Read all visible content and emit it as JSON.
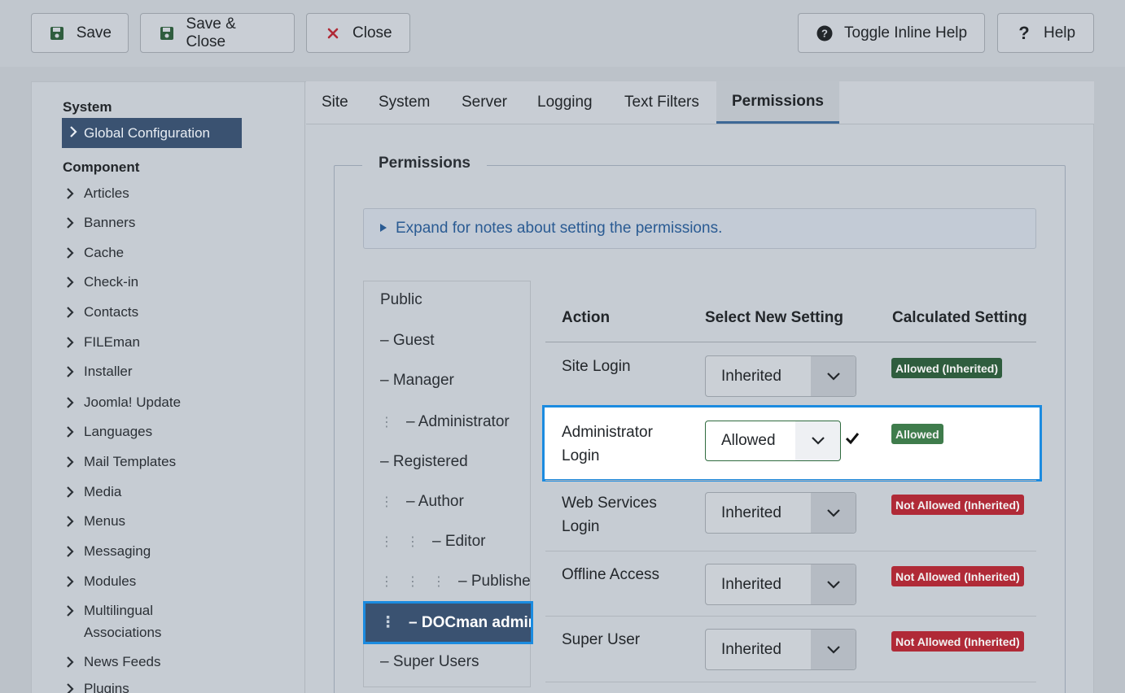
{
  "toolbar": {
    "save": "Save",
    "save_close": "Save & Close",
    "close": "Close",
    "toggle_help": "Toggle Inline Help",
    "help": "Help"
  },
  "sidebar": {
    "system_heading": "System",
    "active_item": "Global Configuration",
    "component_heading": "Component",
    "items": [
      "Articles",
      "Banners",
      "Cache",
      "Check-in",
      "Contacts",
      "FILEman",
      "Installer",
      "Joomla! Update",
      "Languages",
      "Mail Templates",
      "Media",
      "Menus",
      "Messaging",
      "Modules",
      "Multilingual Associations",
      "News Feeds",
      "Plugins"
    ]
  },
  "tabs": [
    "Site",
    "System",
    "Server",
    "Logging",
    "Text Filters",
    "Permissions"
  ],
  "active_tab": "Permissions",
  "permissions": {
    "legend": "Permissions",
    "notes": "Expand for notes about setting the permissions.",
    "groups": [
      {
        "label": "Public",
        "depth": 0
      },
      {
        "label": "– Guest",
        "depth": 0
      },
      {
        "label": "– Manager",
        "depth": 0
      },
      {
        "label": "– Administrator",
        "depth": 1
      },
      {
        "label": "– Registered",
        "depth": 0
      },
      {
        "label": "– Author",
        "depth": 1
      },
      {
        "label": "– Editor",
        "depth": 2
      },
      {
        "label": "– Publisher",
        "depth": 3
      },
      {
        "label": "– DOCman admins",
        "depth": 1
      },
      {
        "label": "– Super Users",
        "depth": 0
      }
    ],
    "active_group": "– DOCman admins",
    "columns": {
      "action": "Action",
      "select": "Select New Setting",
      "calculated": "Calculated Setting"
    },
    "rows": [
      {
        "action": "Site Login",
        "setting": "Inherited",
        "calculated": "Allowed (Inherited)",
        "status": "allowed"
      },
      {
        "action": "Administrator Login",
        "setting": "Allowed",
        "calculated": "Allowed",
        "status": "allowed"
      },
      {
        "action": "Web Services Login",
        "setting": "Inherited",
        "calculated": "Not Allowed (Inherited)",
        "status": "denied"
      },
      {
        "action": "Offline Access",
        "setting": "Inherited",
        "calculated": "Not Allowed (Inherited)",
        "status": "denied"
      },
      {
        "action": "Super User",
        "setting": "Inherited",
        "calculated": "Not Allowed (Inherited)",
        "status": "denied"
      }
    ]
  },
  "colors": {
    "allowed": "#2f5d3e",
    "denied": "#b02a37",
    "accent": "#1b8be0",
    "active_bg": "#3a5271"
  }
}
